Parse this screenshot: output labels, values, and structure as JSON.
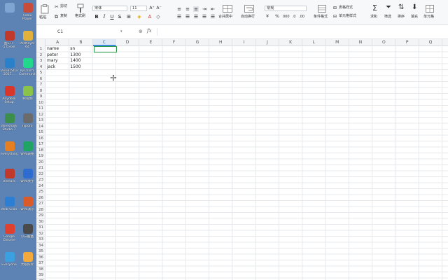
{
  "desktop": {
    "col1": [
      {
        "label": "",
        "icon": "recycle-bin-icon",
        "color": "#7fa5d2"
      },
      {
        "label": "图ETT-\n1.0.exe",
        "icon": "app-icon",
        "color": "#c0392b"
      },
      {
        "label": "Visual Studio\n2017...",
        "icon": "app-icon",
        "color": "#2a80c9"
      },
      {
        "label": "Anydesk\nSetup",
        "icon": "app-icon",
        "color": "#d9362b"
      },
      {
        "label": "Wireshark\nStudio 7",
        "icon": "app-icon",
        "color": "#3c8f4b"
      },
      {
        "label": "everything",
        "icon": "app-icon",
        "color": "#e67e22"
      },
      {
        "label": "Uemark",
        "icon": "app-icon",
        "color": "#c0392b"
      },
      {
        "label": "Web Scan",
        "icon": "app-icon",
        "color": "#2d7fd3"
      },
      {
        "label": "Google\nChrome",
        "icon": "chrome-icon",
        "color": "#e0412f"
      },
      {
        "label": "Everyone",
        "icon": "app-icon",
        "color": "#3aa0e0"
      }
    ],
    "col2": [
      {
        "label": "Video\nPlayer",
        "icon": "app-icon",
        "color": "#c94c3a"
      },
      {
        "label": "PotPlayer\n64",
        "icon": "app-icon",
        "color": "#e2b13b"
      },
      {
        "label": "PyCharm\nCommunity",
        "icon": "pycharm-icon",
        "color": "#21d789"
      },
      {
        "label": "4K视频",
        "icon": "app-icon",
        "color": "#8bc34a"
      },
      {
        "label": "Typora",
        "icon": "app-icon",
        "color": "#6b6b6b"
      },
      {
        "label": "WPS表格",
        "icon": "wps-icon",
        "color": "#1fa463"
      },
      {
        "label": "WPS文字",
        "icon": "wps-icon",
        "color": "#2f6ccf"
      },
      {
        "label": "WPS演示",
        "icon": "wps-icon",
        "color": "#d95b2b"
      },
      {
        "label": "小白截图",
        "icon": "app-icon",
        "color": "#4a4a4a"
      },
      {
        "label": "大眼照片",
        "icon": "app-icon",
        "color": "#f2a93b"
      }
    ]
  },
  "ribbon": {
    "paste": "粘贴",
    "cut": "剪切",
    "copy": "复制",
    "format_painter": "格式刷",
    "font_name": "宋体",
    "font_size": "11",
    "merge_center": "合并居中",
    "wrap_text": "自动换行",
    "number_format": "常规",
    "table_style": "表格样式",
    "cell_style": "单元格样式",
    "fill_format": "条件格式",
    "sum": "求和",
    "filter": "筛选",
    "sort": "排序",
    "fill": "填充",
    "single_cell": "单元格"
  },
  "formula_bar": {
    "name_box": "C1",
    "formula": ""
  },
  "grid": {
    "columns": [
      "A",
      "B",
      "C",
      "D",
      "E",
      "F",
      "G",
      "H",
      "I",
      "J",
      "K",
      "L",
      "M",
      "N",
      "O",
      "P",
      "Q"
    ],
    "active_column": "C",
    "rows": [
      "1",
      "2",
      "3",
      "4",
      "5",
      "6",
      "7",
      "8",
      "9",
      "10",
      "11",
      "12",
      "13",
      "14",
      "15",
      "16",
      "17",
      "18",
      "19",
      "20",
      "21",
      "22",
      "23",
      "24",
      "25",
      "26",
      "27",
      "28",
      "29",
      "30",
      "31",
      "32",
      "33",
      "34",
      "35",
      "36",
      "37",
      "38",
      "39",
      "40"
    ],
    "data": [
      [
        "name",
        "sn"
      ],
      [
        "peter",
        "1300"
      ],
      [
        "mary",
        "1400"
      ],
      [
        "jack",
        "1500"
      ]
    ]
  },
  "colors": {
    "selection": "#2e9a4a",
    "active_header": "#3b8ad9",
    "desktop_bg": "#5d83b4"
  }
}
